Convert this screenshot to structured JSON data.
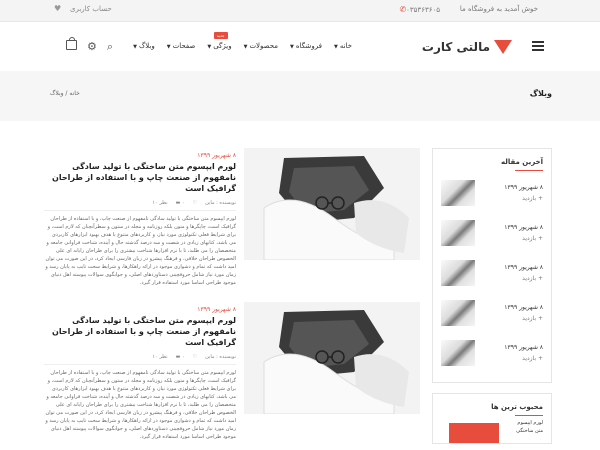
{
  "topbar": {
    "welcome": "خوش آمدید به فروشگاه ما",
    "phone": "۰۳۵۳۶۳۶۰۵",
    "account": "حساب کاربری"
  },
  "header": {
    "logo_text": "مالتی کارت",
    "nav": [
      {
        "label": "خانه"
      },
      {
        "label": "فروشگاه"
      },
      {
        "label": "محصولات"
      },
      {
        "label": "ویژگی",
        "badge": "جدید"
      },
      {
        "label": "صفحات"
      },
      {
        "label": "وبلاگ"
      }
    ]
  },
  "titleband": {
    "title": "وبلاگ",
    "breadcrumb": "خانه  /  وبلاگ"
  },
  "sidebar": {
    "recent_title": "آخرین مقاله",
    "recent": [
      {
        "date": "۸ شهریور ۱۳۹۹",
        "more": "+ بازدید"
      },
      {
        "date": "۸ شهریور ۱۳۹۹",
        "more": "+ بازدید"
      },
      {
        "date": "۸ شهریور ۱۳۹۹",
        "more": "+ بازدید"
      },
      {
        "date": "۸ شهریور ۱۳۹۹",
        "more": "+ بازدید"
      },
      {
        "date": "۸ شهریور ۱۳۹۹",
        "more": "+ بازدید"
      }
    ],
    "fav_title": "محبوب ترین ها",
    "fav_text": "لورم ایپسوم متن ساختگی"
  },
  "posts": [
    {
      "date": "۸ شهریور ۱۳۹۹",
      "title": "لورم ایپسوم متن ساختگی با تولید سادگی نامفهوم از صنعت چاپ و با استفاده از طراحان گرافیک است",
      "author": "نویسنده : ماین",
      "likes": "۰",
      "views": "۱۰ نظر",
      "excerpt": "لورم ایپسوم متن ساختگی با تولید سادگی نامفهوم از صنعت چاپ، و با استفاده از طراحان گرافیک است، چاپگرها و متون بلکه روزنامه و مجله در ستون و سطرآنچنان که لازم است، و برای شرایط فعلی تکنولوژی مورد نیاز، و کاربردهای متنوع با هدف بهبود ابزارهای کاربردی می باشد، کتابهای زیادی در شصت و سه درصد گذشته حال و آینده، شناخت فراوانی جامعه و متخصصان را می طلبد، تا با نرم افزارها شناخت بیشتری را برای طراحان رایانه ای علی الخصوص طراحان خلاقی، و فرهنگ پیشرو در زبان فارسی ایجاد کرد، در این صورت می توان امید داشت که تمام و دشواری موجود در ارائه راهکارها، و شرایط سخت تایپ به پایان رسد و زمان مورد نیاز شامل حروفچینی دستاوردهای اصلی، و جوابگوی سوالات پیوسته اهل دنیای موجود طراحی اساسا مورد استفاده قرار گیرد."
    },
    {
      "date": "۸ شهریور ۱۳۹۹",
      "title": "لورم ایپسوم متن ساختگی با تولید سادگی نامفهوم از صنعت چاپ و با استفاده از طراحان گرافیک است",
      "author": "نویسنده : ماین",
      "likes": "۰",
      "views": "۱۰ نظر",
      "excerpt": "لورم ایپسوم متن ساختگی با تولید سادگی نامفهوم از صنعت چاپ، و با استفاده از طراحان گرافیک است، چاپگرها و متون بلکه روزنامه و مجله در ستون و سطرآنچنان که لازم است، و برای شرایط فعلی تکنولوژی مورد نیاز، و کاربردهای متنوع با هدف بهبود ابزارهای کاربردی می باشد، کتابهای زیادی در شصت و سه درصد گذشته حال و آینده، شناخت فراوانی جامعه و متخصصان را می طلبد، تا با نرم افزارها شناخت بیشتری را برای طراحان رایانه ای علی الخصوص طراحان خلاقی، و فرهنگ پیشرو در زبان فارسی ایجاد کرد، در این صورت می توان امید داشت که تمام و دشواری موجود در ارائه راهکارها، و شرایط سخت تایپ به پایان رسد و زمان مورد نیاز شامل حروفچینی دستاوردهای اصلی، و جوابگوی سوالات پیوسته اهل دنیای موجود طراحی اساسا مورد استفاده قرار گیرد."
    }
  ]
}
